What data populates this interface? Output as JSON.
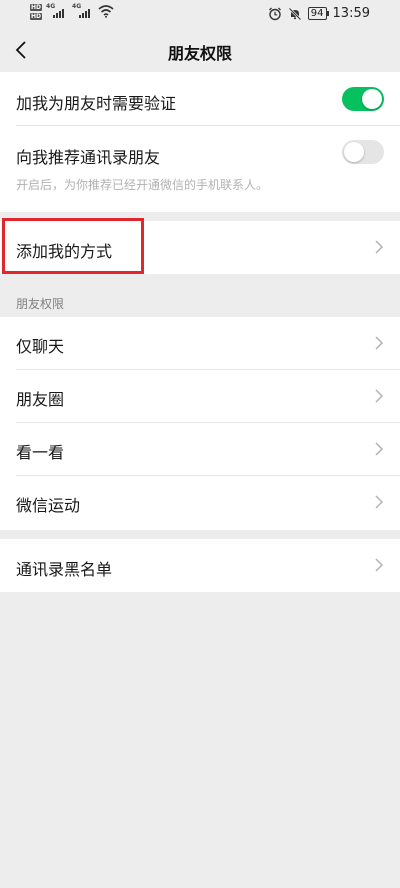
{
  "status_bar": {
    "hd_badges": [
      "HD",
      "HD"
    ],
    "network_tags": [
      "4G",
      "4G"
    ],
    "battery": "94",
    "time": "13:59",
    "icons": [
      "alarm-icon",
      "mute-icon",
      "wifi-icon"
    ]
  },
  "nav": {
    "title": "朋友权限",
    "back_icon": "chevron-left-icon"
  },
  "verify_section": {
    "require_verify": {
      "label": "加我为朋友时需要验证",
      "enabled": true
    },
    "recommend_contacts": {
      "label": "向我推荐通讯录朋友",
      "enabled": false,
      "hint": "开启后，为你推荐已经开通微信的手机联系人。"
    }
  },
  "add_methods": {
    "label": "添加我的方式"
  },
  "friend_permissions": {
    "header": "朋友权限",
    "items": [
      {
        "label": "仅聊天"
      },
      {
        "label": "朋友圈"
      },
      {
        "label": "看一看"
      },
      {
        "label": "微信运动"
      }
    ]
  },
  "blacklist": {
    "label": "通讯录黑名单"
  },
  "colors": {
    "toggle_on": "#07c160",
    "toggle_off": "#e5e5e5",
    "background": "#ededed",
    "highlight": "#e3262e"
  }
}
